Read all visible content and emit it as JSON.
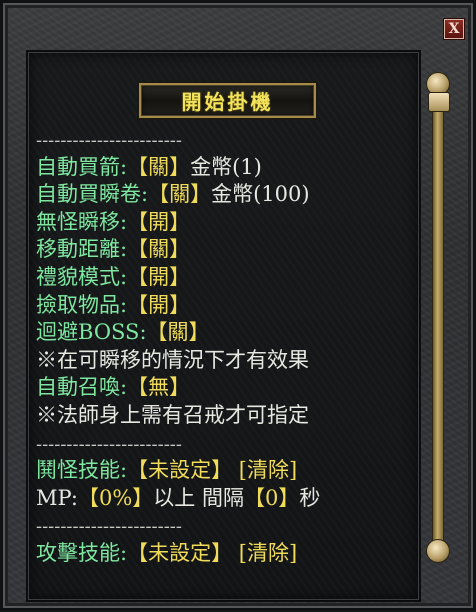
{
  "window": {
    "close_label": "X"
  },
  "start_button": {
    "label": "開始掛機"
  },
  "rows": [
    {
      "type": "sep",
      "text": "------------------------"
    },
    {
      "type": "kv",
      "key": "自動買箭:",
      "value": "【關】",
      "extra": "金幣(1)"
    },
    {
      "type": "kv",
      "key": "自動買瞬卷:",
      "value": "【關】",
      "extra": "金幣(100)"
    },
    {
      "type": "kv",
      "key": "無怪瞬移:",
      "value": "【開】",
      "extra": ""
    },
    {
      "type": "kv",
      "key": "移動距離:",
      "value": "【關】",
      "extra": ""
    },
    {
      "type": "kv",
      "key": "禮貌模式:",
      "value": "【開】",
      "extra": ""
    },
    {
      "type": "kv",
      "key": "撿取物品:",
      "value": "【開】",
      "extra": ""
    },
    {
      "type": "kv",
      "key": "迴避BOSS:",
      "value": "【關】",
      "extra": ""
    },
    {
      "type": "note",
      "text": "※在可瞬移的情況下才有效果"
    },
    {
      "type": "kv",
      "key": "自動召喚:",
      "value": "【無】",
      "extra": ""
    },
    {
      "type": "note",
      "text": "※法師身上需有召戒才可指定"
    },
    {
      "type": "sep",
      "text": "------------------------"
    },
    {
      "type": "skill",
      "key": "鬨怪技能:",
      "value": "【未設定】",
      "action": "[清除]"
    },
    {
      "type": "mp",
      "prefix": "MP:",
      "pct": "【0%】",
      "mid": "以上 間隔",
      "interval": "【0】",
      "suffix": "秒"
    },
    {
      "type": "sep",
      "text": "------------------------"
    },
    {
      "type": "skill",
      "key": "攻擊技能:",
      "value": "【未設定】",
      "action": "[清除]"
    }
  ]
}
